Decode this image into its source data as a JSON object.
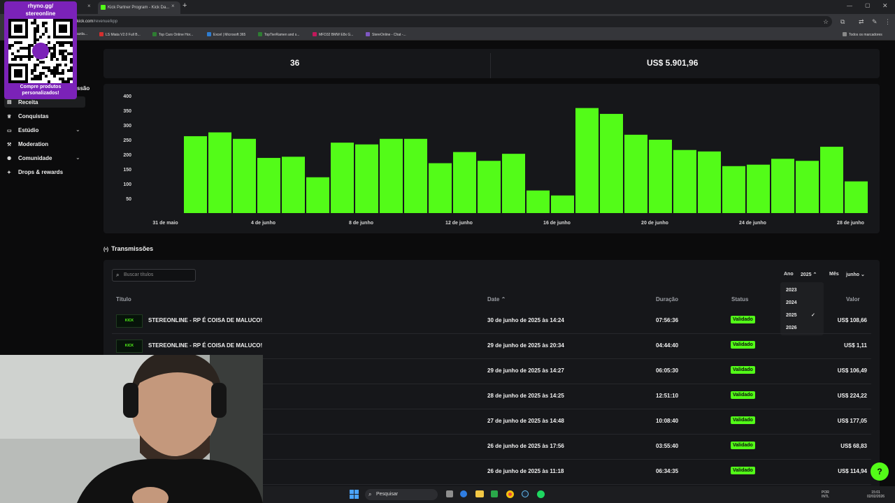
{
  "browser": {
    "tabs": [
      {
        "label": "Kick Partner Program - Kick Da..."
      }
    ],
    "url_host": "kick.com",
    "url_path": "/revenue/kpp",
    "bookmarks": [
      {
        "label": "azda..."
      },
      {
        "label": "LS Miata V2.0 Full B...",
        "color": "#d32f2f"
      },
      {
        "label": "Top Cars Online Hor...",
        "color": "#2e7d32"
      },
      {
        "label": "Excel | Microsoft 365",
        "color": "#2e7dd1"
      },
      {
        "label": "TopTierRamen and s...",
        "color": "#2e7d32"
      },
      {
        "label": "MFD32 BMW E8x G...",
        "color": "#c2185b"
      },
      {
        "label": "StereOnline - Chat -...",
        "color": "#7e57c2"
      }
    ],
    "all_bookmarks": "Todos os marcadores"
  },
  "overlay_qr": {
    "title_line1": "rhyno.gg/",
    "title_line2": "stereonline",
    "caption_line1": "Compre produtos",
    "caption_line2": "personalizados!"
  },
  "sidebar": {
    "partial_label": "ssão",
    "items": [
      {
        "label": "Receita",
        "icon": "receipt-icon",
        "glyph": "▤",
        "active": true
      },
      {
        "label": "Conquistas",
        "icon": "trophy-icon",
        "glyph": "🏆"
      },
      {
        "label": "Estúdio",
        "icon": "monitor-icon",
        "glyph": "▭",
        "expandable": true
      },
      {
        "label": "Moderation",
        "icon": "gavel-icon",
        "glyph": "⚒"
      },
      {
        "label": "Comunidade",
        "icon": "community-icon",
        "glyph": "⚉",
        "expandable": true
      },
      {
        "label": "Drops & rewards",
        "icon": "gift-icon",
        "glyph": "✦"
      }
    ]
  },
  "stats": {
    "count": "36",
    "total": "US$ 5.901,96"
  },
  "chart_data": {
    "type": "bar",
    "color": "#53fc18",
    "ylim": [
      0,
      400
    ],
    "yticks": [
      50,
      100,
      150,
      200,
      250,
      300,
      350,
      400
    ],
    "xtick_labels": [
      "31 de maio",
      "4 de junho",
      "8 de junho",
      "12 de junho",
      "16 de junho",
      "20 de junho",
      "24 de junho",
      "28 de junho"
    ],
    "values": [
      262,
      275,
      253,
      188,
      192,
      122,
      240,
      234,
      253,
      253,
      170,
      208,
      178,
      202,
      77,
      60,
      358,
      338,
      267,
      250,
      215,
      210,
      160,
      165,
      185,
      178,
      226,
      108
    ]
  },
  "section": {
    "title": "Transmissões"
  },
  "filters": {
    "search_placeholder": "Buscar títulos",
    "year_label": "Ano",
    "year_value": "2025",
    "month_label": "Mês",
    "month_value": "junho",
    "year_options": [
      "2023",
      "2024",
      "2025",
      "2026"
    ],
    "selected_year": "2025"
  },
  "table": {
    "headers": {
      "title": "Título",
      "date": "Date",
      "duration": "Duração",
      "status": "Status",
      "value": "Valor"
    },
    "rows": [
      {
        "title": "STEREONLINE - RP É COISA DE MALUCO!",
        "date": "30 de junho de 2025 às 14:24",
        "duration": "07:56:36",
        "status": "Validado",
        "value": "US$ 108,66"
      },
      {
        "title": "STEREONLINE - RP É COISA DE MALUCO!",
        "date": "29 de junho de 2025 às 20:34",
        "duration": "04:44:40",
        "status": "Validado",
        "value": "US$ 1,11"
      },
      {
        "title": "",
        "date": "29 de junho de 2025 às 14:27",
        "duration": "06:05:30",
        "status": "Validado",
        "value": "US$ 106,49"
      },
      {
        "title": "",
        "date": "28 de junho de 2025 às 14:25",
        "duration": "12:51:10",
        "status": "Validado",
        "value": "US$ 224,22"
      },
      {
        "title": "",
        "date": "27 de junho de 2025 às 14:48",
        "duration": "10:08:40",
        "status": "Validado",
        "value": "US$ 177,05"
      },
      {
        "title": "",
        "date": "26 de junho de 2025 às 17:56",
        "duration": "03:55:40",
        "status": "Validado",
        "value": "US$ 68,83"
      },
      {
        "title": "",
        "date": "26 de junho de 2025 às 11:18",
        "duration": "06:34:35",
        "status": "Validado",
        "value": "US$ 114,94"
      }
    ]
  },
  "taskbar": {
    "search_label": "Pesquisar",
    "lang_line1": "POR",
    "lang_line2": "INTL",
    "time": "15:01",
    "date": "02/02/2026"
  }
}
